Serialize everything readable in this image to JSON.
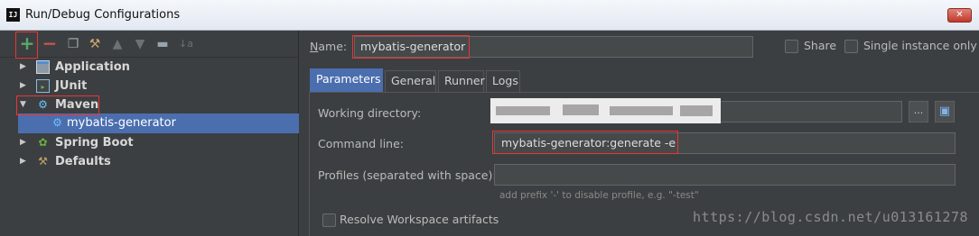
{
  "window": {
    "app_icon": "IJ",
    "title": "Run/Debug Configurations",
    "close_icon": "✕"
  },
  "toolbar": {
    "add_icon": "+",
    "remove_icon": "−",
    "copy_icon": "copy-icon",
    "wrench_icon": "wrench-icon",
    "up_icon": "▲",
    "down_icon": "▼",
    "folder_icon": "folder-icon",
    "sort_icon": "↓a"
  },
  "tree": {
    "items": [
      {
        "label": "Application",
        "icon": "application-icon",
        "expanded": false
      },
      {
        "label": "JUnit",
        "icon": "junit-icon",
        "expanded": false
      },
      {
        "label": "Maven",
        "icon": "maven-gear-icon",
        "expanded": true
      },
      {
        "label": "mybatis-generator",
        "icon": "maven-gear-icon",
        "selected": true
      },
      {
        "label": "Spring Boot",
        "icon": "spring-boot-icon",
        "expanded": false
      },
      {
        "label": "Defaults",
        "icon": "wrench-icon",
        "expanded": false
      }
    ]
  },
  "header": {
    "name_label_prefix": "N",
    "name_label_rest": "ame:",
    "name_value": "mybatis-generator",
    "share_label": "Share",
    "single_instance_label": "Single instance only"
  },
  "tabs": [
    "Parameters",
    "General",
    "Runner",
    "Logs"
  ],
  "params": {
    "working_directory_label": "Working directory:",
    "working_directory_value": "",
    "browse_label": "...",
    "command_line_label": "Command line:",
    "command_line_value": "mybatis-generator:generate -e",
    "profiles_label": "Profiles (separated with space):",
    "profiles_value": "",
    "profiles_hint": "add prefix '-' to disable profile, e.g. \"-test\"",
    "resolve_workspace_label": "Resolve Workspace artifacts"
  },
  "watermark": "https://blog.csdn.net/u013161278",
  "colors": {
    "background": "#3c3f41",
    "selection": "#4b6eaf",
    "highlight_box": "#ee3333",
    "add_green": "#59a869",
    "remove_red": "#c75450"
  }
}
